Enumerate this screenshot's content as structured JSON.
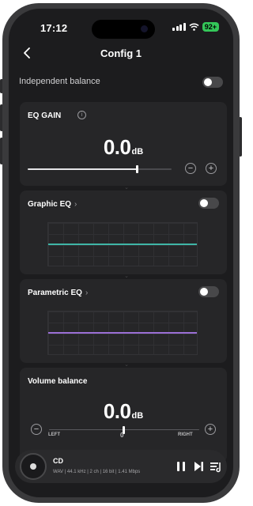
{
  "status": {
    "time": "17:12",
    "battery": "92+"
  },
  "nav": {
    "title": "Config 1"
  },
  "independent_balance": {
    "label": "Independent balance"
  },
  "eq_gain": {
    "title": "EQ GAIN",
    "value": "0.0",
    "unit": "dB",
    "level": 0.76
  },
  "graphic_eq": {
    "title": "Graphic EQ",
    "curve_color": "#3fb5a6"
  },
  "parametric_eq": {
    "title": "Parametric EQ",
    "curve_color": "#9b6fd6"
  },
  "volume_balance": {
    "title": "Volume balance",
    "value": "0.0",
    "unit": "dB",
    "left_label": "LEFT",
    "right_label": "RIGHT",
    "center_label": "0"
  },
  "player": {
    "title": "CD",
    "meta": "WAV | 44.1 kHz | 2 ch | 16 bit | 1.41 Mbps"
  }
}
